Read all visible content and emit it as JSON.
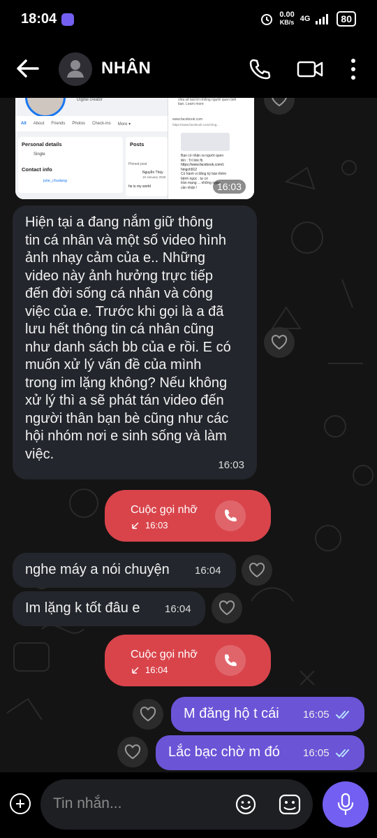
{
  "status_bar": {
    "time": "18:04",
    "speed_value": "0.00",
    "speed_unit": "KB/s",
    "network": "4G",
    "battery": "80"
  },
  "header": {
    "contact_name": "NHÂN"
  },
  "screenshot_preview": {
    "header_text": "Digital creator",
    "tabs": [
      "All",
      "About",
      "Friends",
      "Photos",
      "Check-ins",
      "More ▾"
    ],
    "personal_details": "Personal details",
    "single": "Single",
    "contact_info": "Contact info",
    "handle": "julie_chudang",
    "posts": "Posts",
    "pinned_post": "Pinned post",
    "post_author": "Nguyễn Thùy",
    "post_date": "19 January 2025",
    "post_text": "he is my world",
    "right_top_text": "chia sẻ bài lời những người quen biết bạn. Learn more",
    "url1": "www.facebook.com",
    "url2": "https://www.facebook.com/chng...",
    "msg_line1": "Bạn có nhận ra người quen",
    "msg_line2": "tên : Trí link fb",
    "msg_link": "https://www.facebook.com/c",
    "msg_link2": "hingch912",
    "msg_line3": "Có hành vi đăng ký bán thêm",
    "msg_line4": "bệnh ngọc . tự có",
    "msg_line5": "trần mạng ... những ngày",
    "msg_line6": "cần nhận !",
    "time": "16:03"
  },
  "messages": [
    {
      "type": "incoming",
      "text_lines": [
        "Hiện tại a đang nắm giữ thông",
        "tin cá nhân và một số video hình",
        "ảnh nhạy cảm của e.. Những",
        "video này ảnh hưởng trực tiếp",
        "đến đời sống cá nhân và công",
        "việc của e. Trước khi gọi là a  đã",
        "lưu hết thông tin cá nhân cũng",
        "như danh sách bb của e rồi. E có",
        "muốn xử lý vấn đề của mình",
        "trong im lặng không? Nếu không",
        "xử lý thì a sẽ phát tán video đến",
        "người thân bạn bè cũng như các",
        "hội nhóm nơi e sinh sống và làm",
        "việc."
      ],
      "time": "16:03"
    },
    {
      "type": "missed_call",
      "label": "Cuộc gọi nhỡ",
      "time": "16:03"
    },
    {
      "type": "incoming",
      "text": "nghe máy a nói chuyện",
      "time": "16:04"
    },
    {
      "type": "incoming",
      "text": "Im lặng k tốt đâu e",
      "time": "16:04"
    },
    {
      "type": "missed_call",
      "label": "Cuộc gọi nhỡ",
      "time": "16:04"
    },
    {
      "type": "outgoing",
      "text": "M đăng hộ t cái",
      "time": "16:05",
      "status": "read"
    },
    {
      "type": "outgoing",
      "text": "Lắc bạc chờ m đó",
      "time": "16:05",
      "status": "read"
    }
  ],
  "composer": {
    "placeholder": "Tin nhắn..."
  },
  "colors": {
    "incoming": "#23262c",
    "outgoing": "#6b54d6",
    "missed": "#d9444b",
    "accent": "#7360f2"
  }
}
